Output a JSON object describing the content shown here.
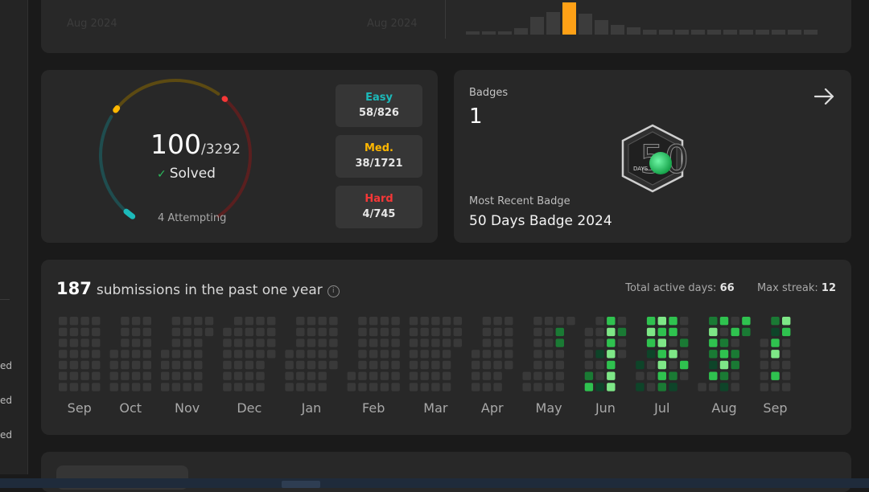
{
  "sidebar": {
    "fragments": [
      "ed",
      "ed",
      "ed"
    ]
  },
  "top_card": {
    "left_date": "Aug 2024",
    "right_date": "Aug 2024",
    "bars": [
      4,
      4,
      4,
      8,
      22,
      28,
      40,
      26,
      18,
      12,
      9,
      6,
      6,
      6,
      6,
      6,
      6,
      6,
      6,
      6,
      6,
      6
    ],
    "highlight_index": 6,
    "colors": {
      "bar": "#3c3c3c",
      "highlight": "#ffa116"
    }
  },
  "progress": {
    "solved": "100",
    "total": "/3292",
    "solved_label": "Solved",
    "attempting": "4 Attempting",
    "gauge": {
      "easy_fraction": 0.0702,
      "medium_fraction": 0.0221,
      "hard_fraction": 0.0054
    },
    "difficulties": [
      {
        "label": "Easy",
        "value": "58/826",
        "color": "#1cbaba"
      },
      {
        "label": "Med.",
        "value": "38/1721",
        "color": "#ffb700"
      },
      {
        "label": "Hard",
        "value": "4/745",
        "color": "#f63737"
      }
    ]
  },
  "badges": {
    "label": "Badges",
    "count": "1",
    "recent_label": "Most Recent Badge",
    "recent_name": "50 Days Badge 2024",
    "icon_text_number": "50",
    "icon_text_days": "DAYS"
  },
  "heatmap": {
    "count": "187",
    "title": "submissions in the past one year",
    "active_label": "Total active days:",
    "active_value": "66",
    "streak_label": "Max streak:",
    "streak_value": "12",
    "months": [
      "Sep",
      "Oct",
      "Nov",
      "Dec",
      "Jan",
      "Feb",
      "Mar",
      "Apr",
      "May",
      "Jun",
      "Jul",
      "Aug",
      "Sep"
    ],
    "colors": {
      "empty": "#393939",
      "l1": "#0e4429",
      "l2": "#1a7a34",
      "l3": "#2fc24f",
      "l4": "#7ee787"
    }
  }
}
